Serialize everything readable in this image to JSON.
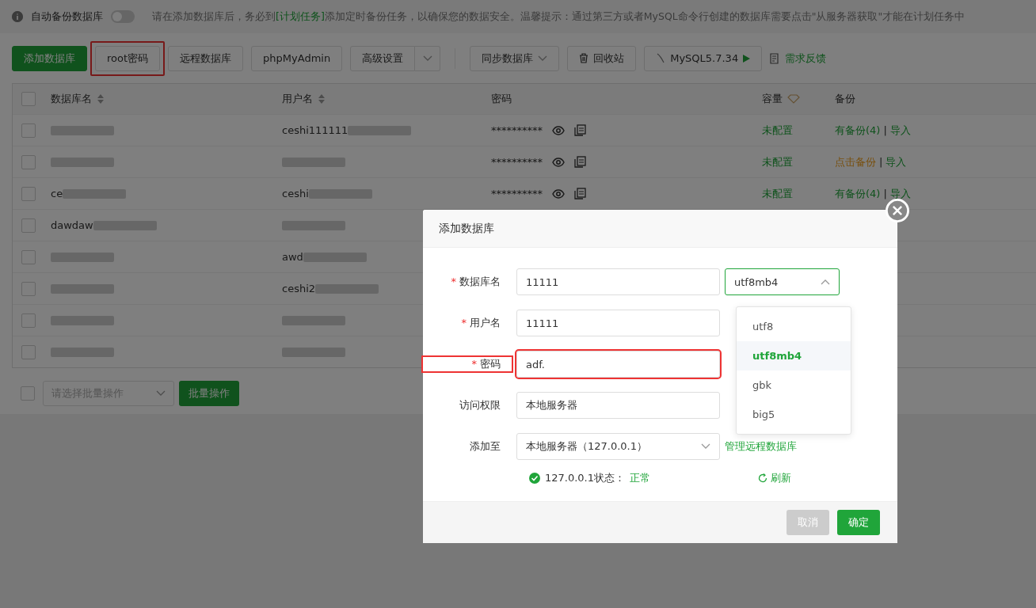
{
  "notice": {
    "label": "自动备份数据库",
    "toggle_on": false,
    "text_before": "请在添加数据库后，务必到",
    "link": "[计划任务]",
    "text_after": "添加定时备份任务，以确保您的数据安全。温馨提示：通过第三方或者MySQL命令行创建的数据库需要点击\"从服务器获取\"才能在计划任务中"
  },
  "toolbar": [
    {
      "kind": "primary",
      "label": "添加数据库",
      "annotated": false
    },
    {
      "kind": "plain",
      "label": "root密码",
      "annotated": true
    },
    {
      "kind": "plain",
      "label": "远程数据库",
      "annotated": false
    },
    {
      "kind": "plain",
      "label": "phpMyAdmin",
      "annotated": false
    },
    {
      "kind": "split",
      "label": "高级设置",
      "annotated": false
    },
    {
      "kind": "dropdown",
      "label": "同步数据库",
      "annotated": false
    },
    {
      "kind": "trash",
      "label": "回收站",
      "annotated": false
    },
    {
      "kind": "mysql",
      "label": "MySQL5.7.34",
      "annotated": false
    },
    {
      "kind": "feedback",
      "label": "需求反馈",
      "annotated": false
    }
  ],
  "table": {
    "columns": [
      "数据库名",
      "用户名",
      "密码",
      "容量",
      "备份"
    ],
    "rows": [
      {
        "checked": false,
        "name": "",
        "user": "ceshi111111",
        "password": "**********",
        "capacity": "未配置",
        "backup": "有备份(4)",
        "kind": "existing",
        "separator": "|",
        "import": "导入"
      },
      {
        "checked": false,
        "name": "",
        "user": "",
        "password": "**********",
        "capacity": "未配置",
        "backup": "点击备份",
        "kind": "pending",
        "separator": "|",
        "import": "导入"
      },
      {
        "checked": false,
        "name": "ce",
        "user": "ceshi",
        "password": "**********",
        "capacity": "未配置",
        "backup": "有备份(4)",
        "kind": "existing",
        "separator": "|",
        "import": "导入"
      },
      {
        "checked": false,
        "name": "dawdaw",
        "user": ""
      },
      {
        "checked": false,
        "name": "",
        "user": "awd"
      },
      {
        "checked": false,
        "name": "",
        "user": "ceshi2"
      },
      {
        "checked": false,
        "name": "",
        "user": ""
      },
      {
        "checked": false,
        "name": "",
        "user": ""
      }
    ],
    "all_checked": false
  },
  "batch": {
    "checked": false,
    "placeholder": "请选择批量操作",
    "button": "批量操作"
  },
  "dialog": {
    "title": "添加数据库",
    "fields": [
      {
        "kind": "charset",
        "required_mark": "*",
        "label": "数据库名",
        "value": "11111",
        "charset": "utf8mb4",
        "annotated": false
      },
      {
        "kind": "text",
        "required_mark": "*",
        "label": "用户名",
        "value": "11111",
        "annotated": false
      },
      {
        "kind": "text",
        "required_mark": "*",
        "label": "密码",
        "value": "adf.",
        "annotated": true
      },
      {
        "kind": "text",
        "label": "访问权限",
        "value": "本地服务器",
        "annotated": false
      },
      {
        "kind": "select",
        "label": "添加至",
        "value": "本地服务器（127.0.0.1）",
        "link": "管理远程数据库",
        "annotated": false
      }
    ],
    "status": {
      "label": "127.0.0.1状态：",
      "value": "正常",
      "refresh": "刷新"
    },
    "charset_options": [
      {
        "label": "utf8",
        "selected": false
      },
      {
        "label": "utf8mb4",
        "selected": true
      },
      {
        "label": "gbk",
        "selected": false
      },
      {
        "label": "big5",
        "selected": false
      }
    ],
    "buttons": [
      {
        "kind": "cancel",
        "label": "取消"
      },
      {
        "kind": "ok",
        "label": "确定"
      }
    ]
  }
}
